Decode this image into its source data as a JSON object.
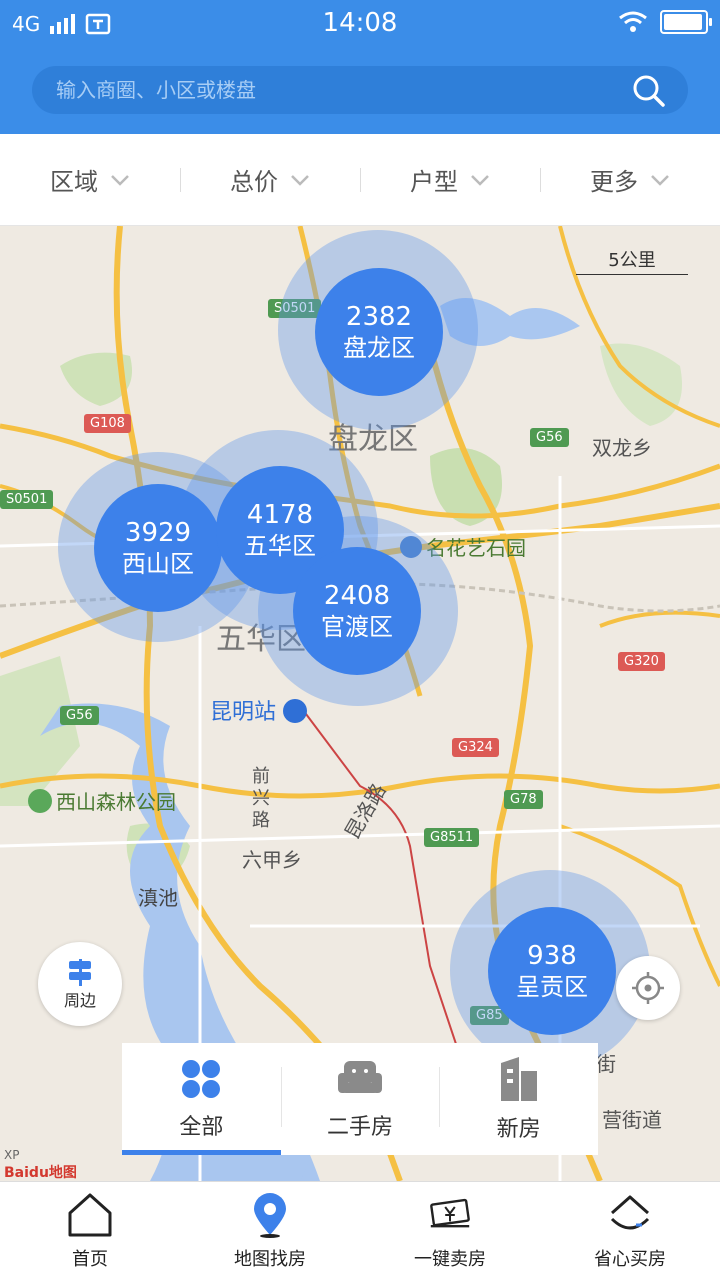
{
  "status_bar": {
    "network": "4G",
    "time": "14:08"
  },
  "search": {
    "placeholder": "输入商圈、小区或楼盘"
  },
  "filters": [
    {
      "label": "区域"
    },
    {
      "label": "总价"
    },
    {
      "label": "户型"
    },
    {
      "label": "更多"
    }
  ],
  "map": {
    "scale": "5公里",
    "place_labels": {
      "panlong_district": "盘龙区",
      "wuhua_district": "五华区",
      "shuanglong": "双龙乡",
      "minghua_park": "名花艺石园",
      "kunming_station": "昆明站",
      "xishan_forest": "西山森林公园",
      "dianchi": "滇池",
      "liujia": "六甲乡",
      "qianxing_road": "前兴路",
      "kunluo_road": "昆洛路",
      "street1": "街",
      "street2": "营街道"
    },
    "highway_shields": {
      "s0501_top": "S0501",
      "s0501_left": "S0501",
      "g108": "G108",
      "g56_top": "G56",
      "g56_left": "G56",
      "g320": "G320",
      "g324": "G324",
      "g78": "G78",
      "g8511": "G8511",
      "g85_bottom": "G85"
    },
    "clusters": [
      {
        "count": "2382",
        "name": "盘龙区"
      },
      {
        "count": "3929",
        "name": "西山区"
      },
      {
        "count": "4178",
        "name": "五华区"
      },
      {
        "count": "2408",
        "name": "官渡区"
      },
      {
        "count": "938",
        "name": "呈贡区"
      }
    ],
    "nearby_label": "周边",
    "baidu_logo": "Baidu地图",
    "xp_label": "XP"
  },
  "property_types": [
    {
      "label": "全部",
      "active": true
    },
    {
      "label": "二手房",
      "active": false
    },
    {
      "label": "新房",
      "active": false
    }
  ],
  "bottom_nav": [
    {
      "label": "首页"
    },
    {
      "label": "地图找房"
    },
    {
      "label": "一键卖房"
    },
    {
      "label": "省心买房"
    }
  ],
  "colors": {
    "primary": "#3b8de8",
    "cluster": "#3d81ea",
    "highway_red": "#dc5a55",
    "highway_green": "#4f9a52"
  }
}
